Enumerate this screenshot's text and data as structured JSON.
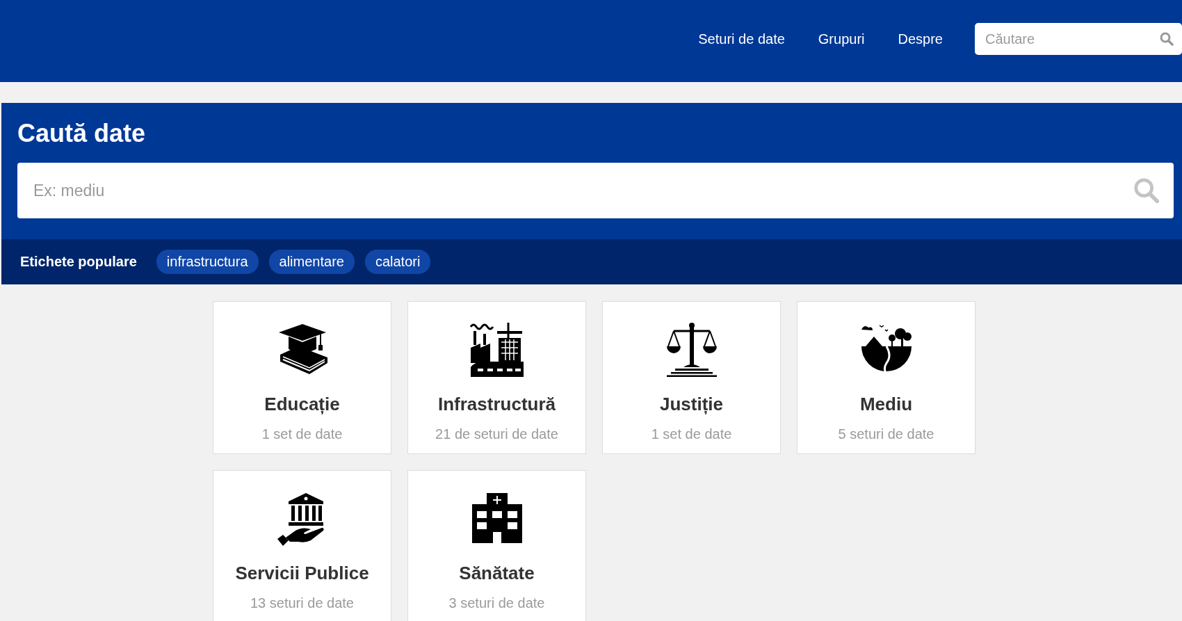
{
  "nav": {
    "links": [
      "Seturi de date",
      "Grupuri",
      "Despre"
    ],
    "search": {
      "placeholder": "Căutare"
    }
  },
  "hero": {
    "title": "Caută date",
    "search": {
      "placeholder": "Ex: mediu"
    }
  },
  "tags": {
    "label": "Etichete populare",
    "items": [
      "infrastructura",
      "alimentare",
      "calatori"
    ]
  },
  "categories": [
    {
      "kind": "education",
      "title": "Educație",
      "count": "1 set de date"
    },
    {
      "kind": "industry",
      "title": "Infrastructură",
      "count": "21 de seturi de date"
    },
    {
      "kind": "justice",
      "title": "Justiție",
      "count": "1 set de date"
    },
    {
      "kind": "environment",
      "title": "Mediu",
      "count": "5 seturi de date"
    },
    {
      "kind": "public",
      "title": "Servicii Publice",
      "count": "13 seturi de date"
    },
    {
      "kind": "health",
      "title": "Sănătate",
      "count": "3 seturi de date"
    }
  ]
}
